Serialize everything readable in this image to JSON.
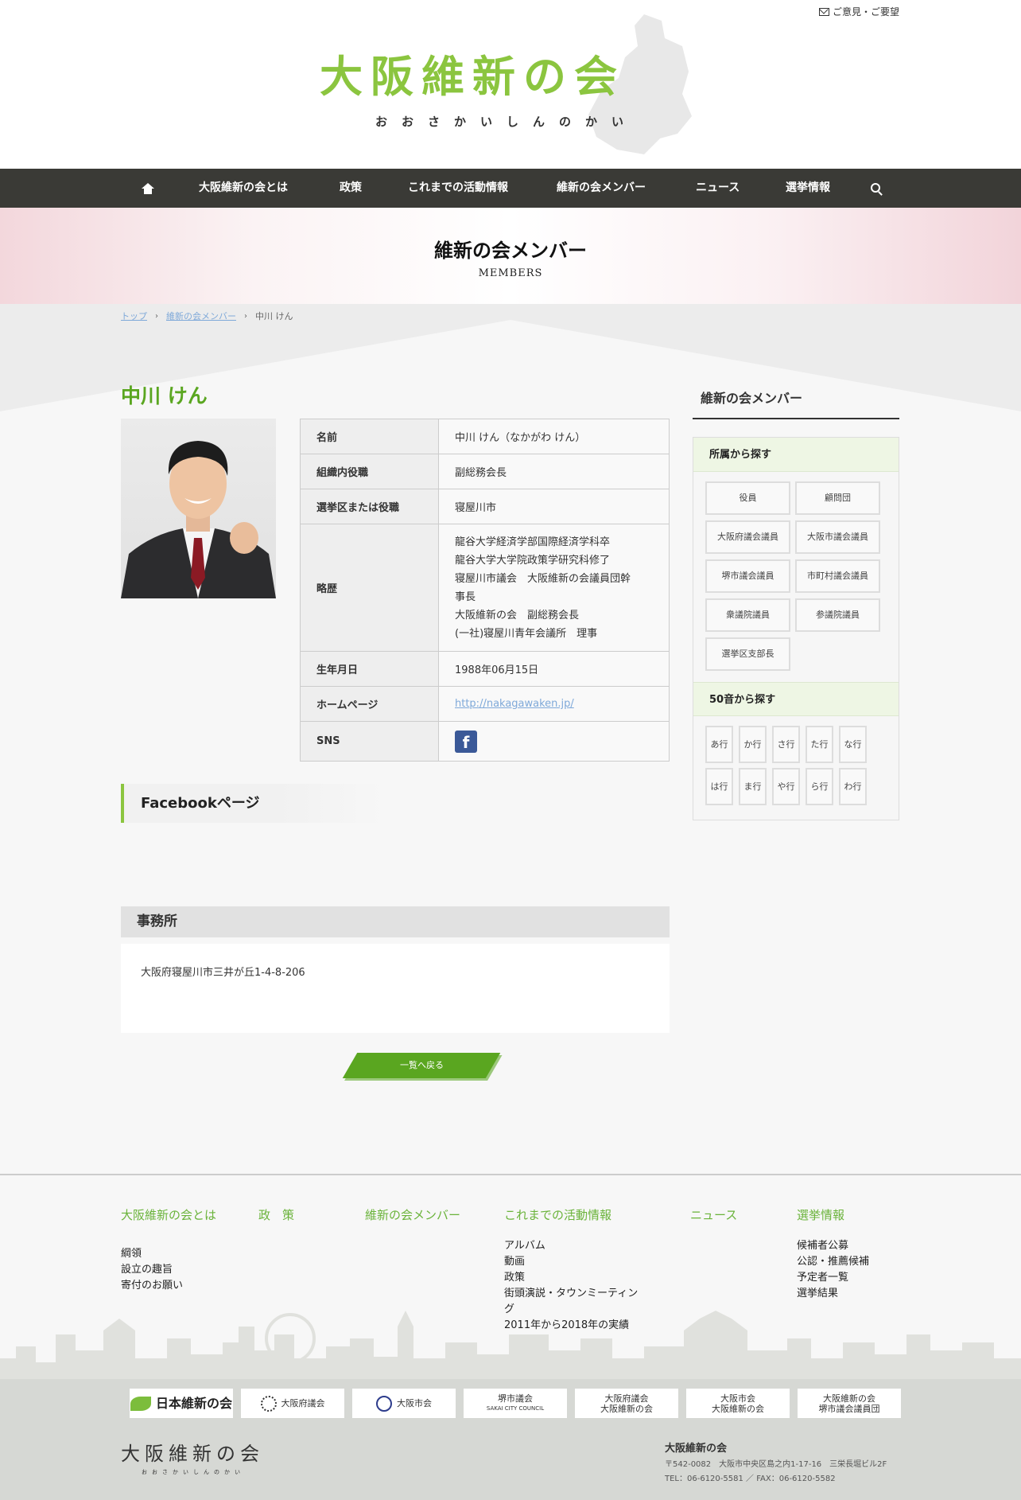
{
  "header": {
    "contact_label": "ご意見・ご要望",
    "logo_main": "大阪維新の会",
    "logo_sub": "おおさかいしんのかい"
  },
  "nav": {
    "items": [
      {
        "label": "大阪維新の会とは"
      },
      {
        "label": "政策"
      },
      {
        "label": "これまでの活動情報"
      },
      {
        "label": "維新の会メンバー"
      },
      {
        "label": "ニュース"
      },
      {
        "label": "選挙情報"
      }
    ]
  },
  "page": {
    "title": "維新の会メンバー",
    "subtitle": "MEMBERS"
  },
  "breadcrumb": {
    "top": "トップ",
    "members": "維新の会メンバー",
    "current": "中川 けん"
  },
  "member": {
    "name": "中川 けん",
    "table": [
      {
        "label": "名前",
        "value": "中川 けん（なかがわ けん）"
      },
      {
        "label": "組織内役職",
        "value": "副総務会長"
      },
      {
        "label": "選挙区または役職",
        "value": "寝屋川市"
      },
      {
        "label": "略歴",
        "lines": [
          "龍谷大学経済学部国際経済学科卒",
          "龍谷大学大学院政策学研究科修了",
          "寝屋川市議会　大阪維新の会議員団幹",
          "事長",
          "大阪維新の会　副総務会長",
          "(一社)寝屋川青年会議所　理事"
        ]
      },
      {
        "label": "生年月日",
        "value": "1988年06月15日"
      },
      {
        "label": "ホームページ",
        "value": "http://nakagawaken.jp/"
      },
      {
        "label": "SNS",
        "icon": "facebook-icon"
      }
    ],
    "facebook_heading": "Facebookページ",
    "office_heading": "事務所",
    "office_address": "大阪府寝屋川市三井が丘1-4-8-206",
    "back_button": "一覧へ戻る"
  },
  "sidebar": {
    "title": "維新の会メンバー",
    "affiliation_heading": "所属から探す",
    "affiliations": [
      "役員",
      "顧問団",
      "大阪府議会議員",
      "大阪市議会議員",
      "堺市議会議員",
      "市町村議会議員",
      "衆議院議員",
      "参議院議員",
      "選挙区支部長"
    ],
    "kana_heading": "50音から探す",
    "kana": [
      "あ行",
      "か行",
      "さ行",
      "た行",
      "な行",
      "は行",
      "ま行",
      "や行",
      "ら行",
      "わ行"
    ]
  },
  "footer": {
    "col1": {
      "title": "大阪維新の会とは",
      "links": [
        "綱領",
        "設立の趣旨",
        "寄付のお願い"
      ]
    },
    "col2": {
      "title": "政　策"
    },
    "col3": {
      "title": "維新の会メンバー"
    },
    "col4": {
      "title": "これまでの活動情報",
      "links": [
        "アルバム",
        "動画",
        "政策",
        "街頭演説・タウンミーティング",
        "2011年から2018年の実績"
      ]
    },
    "col5": {
      "title": "ニュース"
    },
    "col6": {
      "title": "選挙情報",
      "links": [
        "候補者公募",
        "公認・推薦候補",
        "予定者一覧",
        "選挙結果"
      ]
    },
    "banners": [
      {
        "label": "日本維新の会"
      },
      {
        "label": "大阪府議会"
      },
      {
        "label": "大阪市会"
      },
      {
        "line1": "堺市議会",
        "line2": "SAKAI CITY COUNCIL"
      },
      {
        "line1": "大阪府議会",
        "line2": "大阪維新の会"
      },
      {
        "line1": "大阪市会",
        "line2": "大阪維新の会"
      },
      {
        "line1": "大阪維新の会",
        "line2": "堺市議会議員団"
      }
    ],
    "logo_main": "大阪維新の会",
    "logo_sub": "おおさかいしんのかい",
    "org_name": "大阪維新の会",
    "address": "〒542-0082　大阪市中央区島之内1-17-16　三栄長堀ビル2F",
    "tel_fax": "TEL：06-6120-5581 ／ FAX：06-6120-5582"
  },
  "colors": {
    "brand_green": "#8bc53f",
    "dark_nav": "#3a3a36",
    "link_blue": "#7fa9d9"
  }
}
